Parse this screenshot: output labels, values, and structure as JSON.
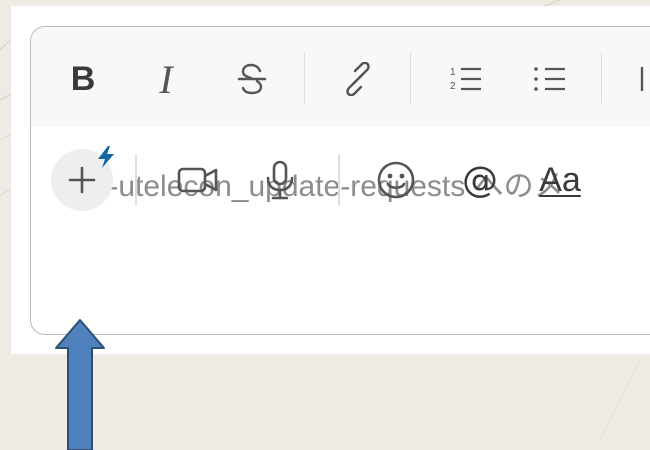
{
  "composer": {
    "placeholder": "#gr-utelecon_update-requests へのメ"
  },
  "format_toolbar": {
    "bold_glyph": "B",
    "italic_glyph": "I"
  },
  "bottom_toolbar": {
    "mention_glyph": "@",
    "text_format_glyph": "Aa"
  },
  "icons": {
    "bold": "bold-icon",
    "italic": "italic-icon",
    "strikethrough": "strikethrough-icon",
    "link": "link-icon",
    "ordered_list": "ordered-list-icon",
    "bullet_list": "bullet-list-icon",
    "block_quote": "block-quote-icon",
    "attach": "plus-icon",
    "shortcut": "lightning-bolt-icon",
    "video": "video-camera-icon",
    "audio": "microphone-icon",
    "emoji": "emoji-smile-icon",
    "mention": "at-sign-icon",
    "format": "text-format-icon"
  },
  "colors": {
    "page_background": "#efebe4",
    "lightning_badge": "#1264a3",
    "annotation_arrow_fill": "#4f81bd",
    "annotation_arrow_stroke": "#2e4f73",
    "placeholder_text": "#8c8c8c"
  }
}
